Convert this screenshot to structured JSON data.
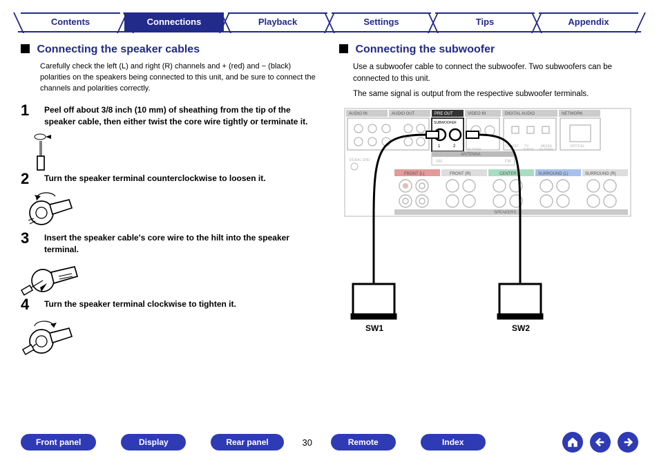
{
  "topnav": {
    "tabs": [
      {
        "label": "Contents"
      },
      {
        "label": "Connections",
        "active": true
      },
      {
        "label": "Playback"
      },
      {
        "label": "Settings"
      },
      {
        "label": "Tips"
      },
      {
        "label": "Appendix"
      }
    ]
  },
  "left": {
    "heading": "Connecting the speaker cables",
    "intro": "Carefully check the left (L) and right (R) channels and + (red) and − (black) polarities on the speakers being connected to this unit, and be sure to connect the channels and polarities correctly.",
    "steps": [
      {
        "n": "1",
        "text": "Peel off about 3/8 inch (10 mm) of sheathing from the tip of the speaker cable, then either twist the core wire tightly or terminate it."
      },
      {
        "n": "2",
        "text": "Turn the speaker terminal counterclockwise to loosen it."
      },
      {
        "n": "3",
        "text": "Insert the speaker cable's core wire to the hilt into the speaker terminal."
      },
      {
        "n": "4",
        "text": "Turn the speaker terminal clockwise to tighten it."
      }
    ]
  },
  "right": {
    "heading": "Connecting the subwoofer",
    "para1": "Use a subwoofer cable to connect the subwoofer. Two subwoofers can be connected to this unit.",
    "para2": "The same signal is output from the respective subwoofer terminals.",
    "panel": {
      "group_labels": [
        "AUDIO IN",
        "AUDIO OUT",
        "PRE OUT",
        "VIDEO",
        "DIGITAL AUDIO",
        "NETWORK"
      ],
      "antenna_label": "ANTENNA",
      "am_label": "AM",
      "fm_label": "FM",
      "speakers_title": "SPEAKERS",
      "speaker_groups": [
        {
          "label": "FRONT (L)",
          "color": "#d83a3a"
        },
        {
          "label": "FRONT (R)",
          "color": "#cfcfcf"
        },
        {
          "label": "CENTER",
          "color": "#2c9f6f"
        },
        {
          "label": "SURROUND (L)",
          "color": "#3a6fd8"
        },
        {
          "label": "SURROUND (R)",
          "color": "#cfcfcf"
        }
      ],
      "small_labels": [
        "3 MEDIA PLAYER",
        "CD-/SAT CD-ROM",
        "TV AUDIO",
        "MEDIA PLAYER",
        "OPTICAL"
      ]
    },
    "sw_labels": [
      "SW1",
      "SW2"
    ]
  },
  "bottom": {
    "buttons_left": [
      "Front panel",
      "Display",
      "Rear panel"
    ],
    "buttons_right": [
      "Remote",
      "Index"
    ],
    "page": "30"
  },
  "icons": {
    "home": "home-icon",
    "prev": "arrow-left-icon",
    "next": "arrow-right-icon"
  }
}
